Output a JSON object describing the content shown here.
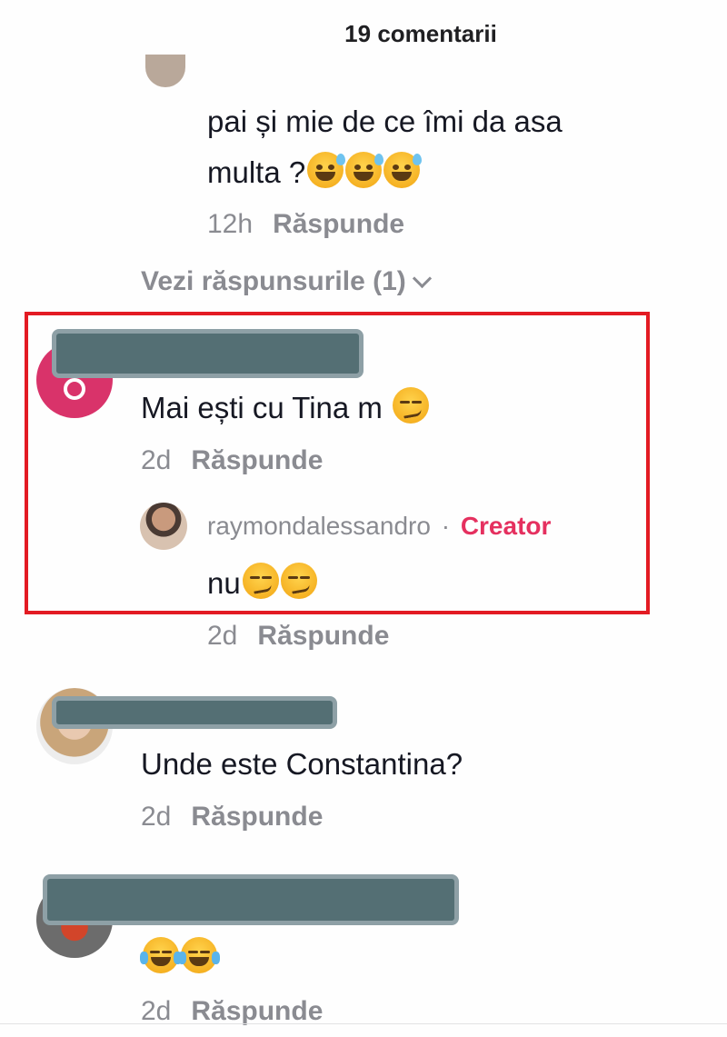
{
  "header": {
    "title": "19 comentarii"
  },
  "comments": [
    {
      "text": "pai și mie de ce îmi da asa",
      "text2": "multa ?",
      "emoji": [
        "sweat-smile-emoji",
        "sweat-smile-emoji",
        "sweat-smile-emoji"
      ],
      "time": "12h",
      "reply_label": "Răspunde",
      "view_replies": "Vezi răspunsurile (1)"
    },
    {
      "text": "Mai ești cu Tina m",
      "emoji": [
        "smirk-emoji"
      ],
      "time": "2d",
      "reply_label": "Răspunde",
      "reply": {
        "username": "raymondalessandro",
        "separator": "·",
        "badge": "Creator",
        "text": "nu",
        "emoji": [
          "smirk-emoji",
          "smirk-emoji"
        ],
        "time": "2d",
        "reply_label": "Răspunde"
      }
    },
    {
      "text": "Unde este Constantina?",
      "time": "2d",
      "reply_label": "Răspunde"
    },
    {
      "text": "",
      "emoji": [
        "tears-of-joy-emoji",
        "tears-of-joy-emoji"
      ],
      "time": "2d",
      "reply_label": "Răspunde"
    }
  ],
  "colors": {
    "creator_badge": "#e5305f",
    "highlight": "#e31b23",
    "redaction": "#546f74"
  }
}
